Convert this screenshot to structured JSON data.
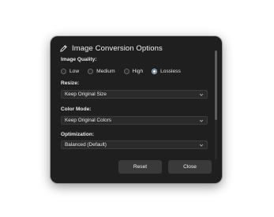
{
  "dialog": {
    "title": "Image Conversion Options",
    "icon": "pencil-icon"
  },
  "image_quality": {
    "label": "Image Quality:",
    "options": [
      "Low",
      "Medium",
      "High",
      "Lossless"
    ],
    "selected": "Lossless"
  },
  "resize": {
    "label": "Resize:",
    "value": "Keep Original Size"
  },
  "color_mode": {
    "label": "Color Mode:",
    "value": "Keep Original Colors"
  },
  "optimization": {
    "label": "Optimization:",
    "value": "Balanced (Default)"
  },
  "buttons": {
    "reset": "Reset",
    "close": "Close"
  },
  "colors": {
    "dialog_bg": "#1f1f1f",
    "button_bg": "#3a3a3a",
    "select_bg": "#2b2b2b",
    "radio_selected": "#9ad0ff"
  }
}
